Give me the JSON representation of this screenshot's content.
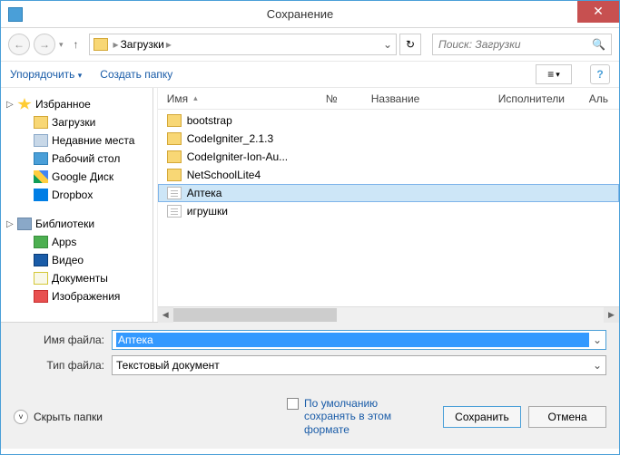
{
  "window": {
    "title": "Сохранение"
  },
  "nav": {
    "path_item": "Загрузки",
    "search_placeholder": "Поиск: Загрузки"
  },
  "toolbar": {
    "organize": "Упорядочить",
    "new_folder": "Создать папку"
  },
  "sidebar": {
    "favorites": {
      "label": "Избранное",
      "items": [
        "Загрузки",
        "Недавние места",
        "Рабочий стол",
        "Google Диск",
        "Dropbox"
      ]
    },
    "libraries": {
      "label": "Библиотеки",
      "items": [
        "Apps",
        "Видео",
        "Документы",
        "Изображения"
      ]
    }
  },
  "columns": {
    "name": "Имя",
    "num": "№",
    "title": "Название",
    "performers": "Исполнители",
    "album": "Аль"
  },
  "files": [
    {
      "name": "bootstrap",
      "type": "folder"
    },
    {
      "name": "CodeIgniter_2.1.3",
      "type": "folder"
    },
    {
      "name": "CodeIgniter-Ion-Au...",
      "type": "folder"
    },
    {
      "name": "NetSchoolLite4",
      "type": "folder"
    },
    {
      "name": "Аптека",
      "type": "file",
      "selected": true
    },
    {
      "name": "игрушки",
      "type": "file"
    }
  ],
  "form": {
    "filename_label": "Имя файла:",
    "filename_value": "Аптека",
    "filetype_label": "Тип файла:",
    "filetype_value": "Текстовый документ"
  },
  "footer": {
    "hide_folders": "Скрыть папки",
    "checkbox_label": "По умолчанию сохранять в этом формате",
    "save": "Сохранить",
    "cancel": "Отмена"
  }
}
